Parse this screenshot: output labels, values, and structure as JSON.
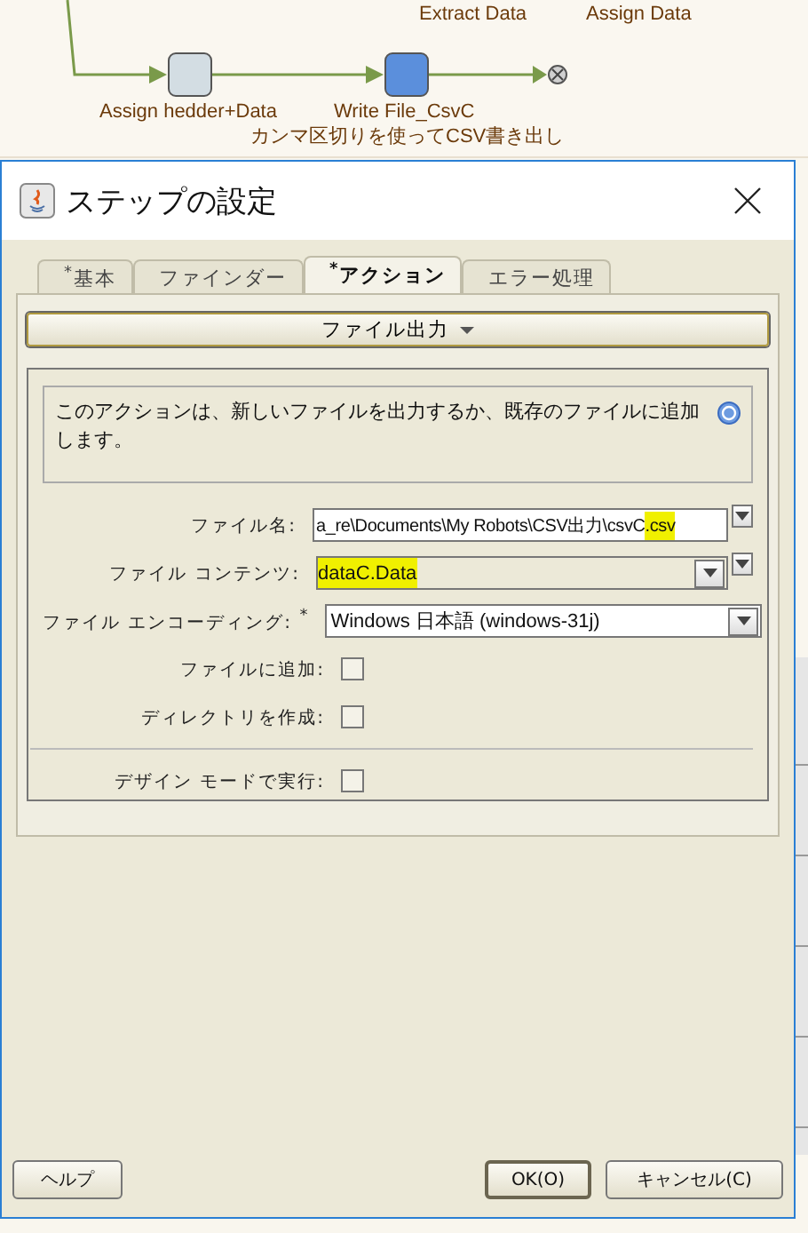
{
  "canvas": {
    "top_labels": [
      "Extract Data",
      "Assign Data"
    ],
    "steps": [
      {
        "label": "Assign hedder+Data",
        "selected": false
      },
      {
        "label": "Write File_CsvC",
        "selected": true
      }
    ],
    "comment": "カンマ区切りを使ってCSV書き出し"
  },
  "dialog": {
    "title": "ステップの設定",
    "tabs": [
      {
        "label": "$^{*}$基本",
        "selected": false
      },
      {
        "label": "ファインダー",
        "selected": false
      },
      {
        "label": "$^{*}$アクション",
        "selected": true
      },
      {
        "label": "エラー処理",
        "selected": false
      }
    ],
    "action_menu": "ファイル出力",
    "description": "このアクションは、新しいファイルを出力するか、既存のファイルに追加します。",
    "fields": [
      {
        "kind": "text",
        "label": "ファイル名:",
        "value": "a_re\\Documents\\My Robots\\CSV出力\\csvC",
        "highlight": ".csv"
      },
      {
        "kind": "combo",
        "label": "ファイル コンテンツ:",
        "highlight": "dataC.Data"
      },
      {
        "kind": "select",
        "label": "ファイル エンコーディング: $^{*}$",
        "value": "Windows 日本語 (windows-31j)"
      },
      {
        "kind": "checkbox",
        "label": "ファイルに追加:",
        "checked": false
      },
      {
        "kind": "checkbox",
        "label": "ディレクトリを作成:",
        "checked": false
      },
      {
        "kind": "divider"
      },
      {
        "kind": "checkbox",
        "label": "デザイン モードで実行:",
        "checked": false
      }
    ],
    "buttons": [
      {
        "label": "ヘルプ",
        "default": false
      },
      {
        "label": "OK(O)",
        "default": true
      },
      {
        "label": "キャンセル(C)",
        "default": false
      }
    ]
  }
}
